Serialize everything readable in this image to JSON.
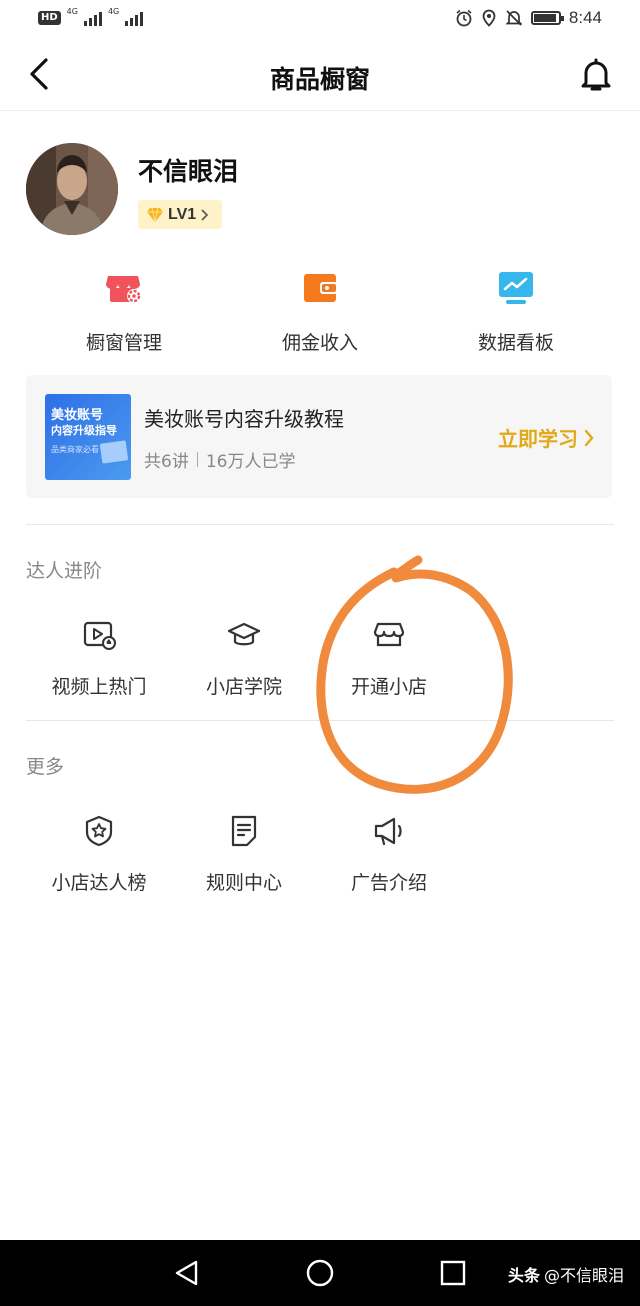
{
  "status_bar": {
    "hd_label": "HD",
    "network_1": "4G",
    "network_2": "4G",
    "time": "8:44",
    "battery_level": 0.9,
    "icons": [
      "alarm-icon",
      "location-icon",
      "mute-icon",
      "battery-icon"
    ]
  },
  "header": {
    "title": "商品橱窗",
    "back_icon": "back-arrow-icon",
    "bell_icon": "bell-icon"
  },
  "profile": {
    "username": "不信眼泪",
    "level": "LV1"
  },
  "tools": [
    {
      "label": "橱窗管理",
      "icon": "shop-settings-icon",
      "color": "#f0535b"
    },
    {
      "label": "佣金收入",
      "icon": "wallet-icon",
      "color": "#f57a1e"
    },
    {
      "label": "数据看板",
      "icon": "monitor-chart-icon",
      "color": "#35b6ec"
    }
  ],
  "course": {
    "thumb_title": "美妆账号",
    "thumb_subtitle": "内容升级指导",
    "thumb_note": "品类商家必看",
    "title": "美妆账号内容升级教程",
    "lessons": "共6讲",
    "learners": "16万人已学",
    "action": "立即学习",
    "accent": "#e1a917"
  },
  "advanced": {
    "title": "达人进阶",
    "items": [
      {
        "label": "视频上热门",
        "icon": "video-hot-icon"
      },
      {
        "label": "小店学院",
        "icon": "graduation-cap-icon"
      },
      {
        "label": "开通小店",
        "icon": "store-icon"
      }
    ]
  },
  "more": {
    "title": "更多",
    "items": [
      {
        "label": "小店达人榜",
        "icon": "star-badge-icon"
      },
      {
        "label": "规则中心",
        "icon": "document-icon"
      },
      {
        "label": "广告介绍",
        "icon": "megaphone-icon"
      }
    ]
  },
  "annotation": {
    "color": "#f08a3c"
  },
  "nav": {
    "watermark_brand": "头条",
    "watermark_user": "@不信眼泪"
  }
}
